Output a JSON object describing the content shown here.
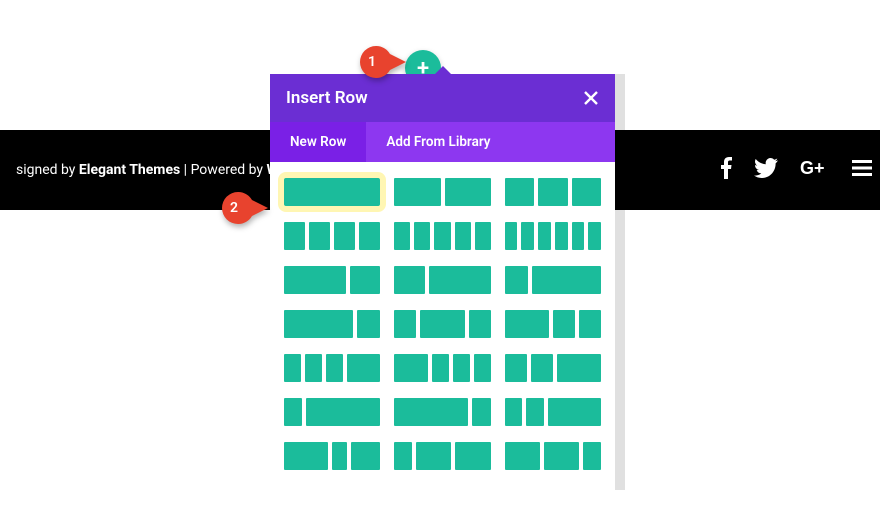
{
  "footer": {
    "prefix": "signed by ",
    "brand": "Elegant Themes",
    "sep": " | Powered by ",
    "platform": "Wo",
    "social": [
      "facebook",
      "twitter",
      "google-plus",
      "menu"
    ]
  },
  "add_button": {
    "glyph": "+"
  },
  "modal": {
    "title": "Insert Row",
    "tabs": [
      {
        "label": "New Row",
        "active": true
      },
      {
        "label": "Add From Library",
        "active": false
      }
    ],
    "layouts": [
      {
        "cols": [
          1
        ],
        "highlight": true
      },
      {
        "cols": [
          1,
          1
        ]
      },
      {
        "cols": [
          1,
          1,
          1
        ]
      },
      {
        "cols": [
          1,
          1,
          1,
          1
        ]
      },
      {
        "cols": [
          1,
          1,
          1,
          1,
          1
        ]
      },
      {
        "cols": [
          1,
          1,
          1,
          1,
          1,
          1
        ]
      },
      {
        "cols": [
          2,
          1
        ]
      },
      {
        "cols": [
          1,
          2
        ]
      },
      {
        "cols": [
          1,
          3
        ]
      },
      {
        "cols": [
          3,
          1
        ]
      },
      {
        "cols": [
          1,
          2,
          1
        ]
      },
      {
        "cols": [
          2,
          1,
          1
        ]
      },
      {
        "cols": [
          1,
          1,
          1,
          2
        ]
      },
      {
        "cols": [
          2,
          1,
          1,
          1
        ]
      },
      {
        "cols": [
          1,
          1,
          2
        ]
      },
      {
        "cols": [
          1,
          4
        ]
      },
      {
        "cols": [
          4,
          1
        ]
      },
      {
        "cols": [
          1,
          1,
          3
        ]
      },
      {
        "cols": [
          3,
          1,
          2
        ]
      },
      {
        "cols": [
          1,
          2,
          2
        ]
      },
      {
        "cols": [
          2,
          2,
          1
        ]
      }
    ]
  },
  "callouts": {
    "one": "1",
    "two": "2"
  },
  "colors": {
    "accent": "#1bbc9b",
    "modal_header": "#6b2ed3",
    "modal_tabbar": "#8d37f0",
    "modal_tab_active": "#7a20e6",
    "highlight": "#fff6b3",
    "callout": "#e8432e"
  }
}
